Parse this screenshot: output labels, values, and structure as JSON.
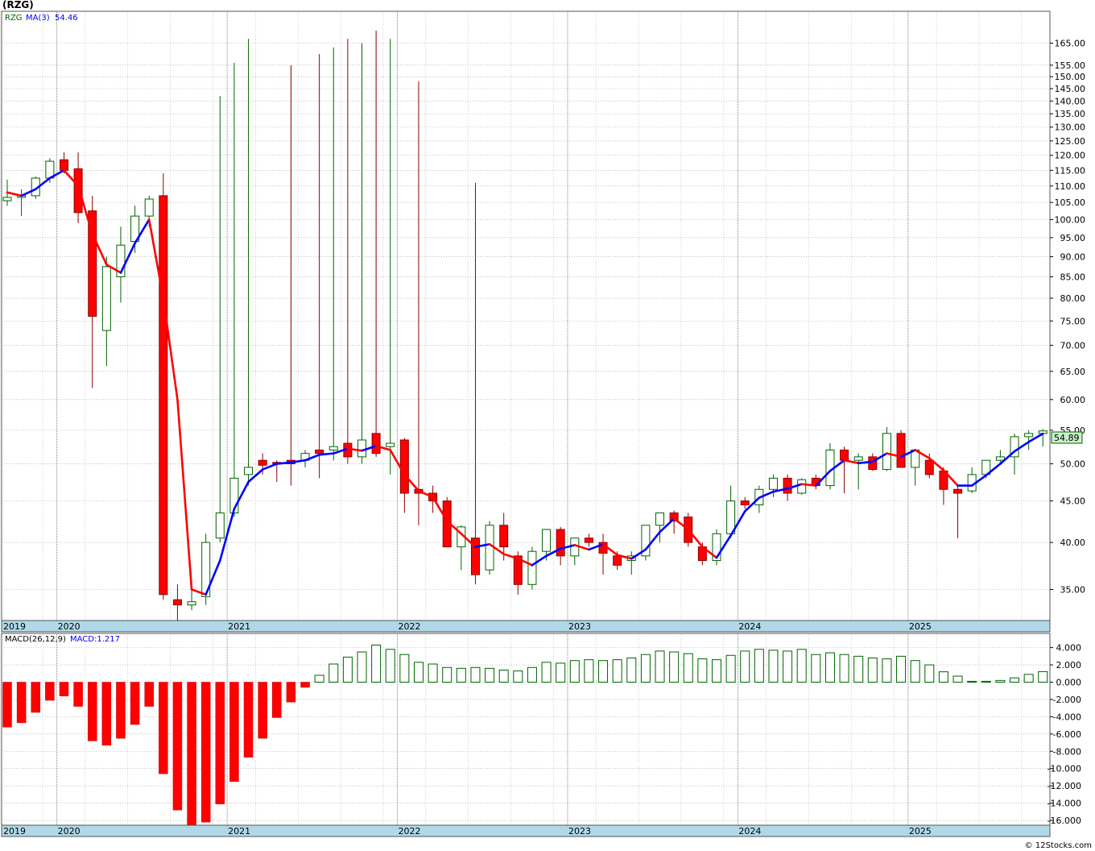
{
  "header": {
    "title": "(RZG)"
  },
  "legend": {
    "ticker": "RZG",
    "ma_label": "MA(3)",
    "ma_value": "54.46",
    "last_price": "54.89",
    "macd_label": "MACD(26,12,9)",
    "macd_value": "MACD:1.217"
  },
  "footer": {
    "copyright": "© 12Stocks.com"
  },
  "colors": {
    "up_candle": "#006400",
    "down_candle": "#8b0000",
    "down_fill": "#ff0000",
    "ma_up": "#0000ff",
    "ma_down": "#ff0000",
    "axis_band": "#b0d8e8",
    "last_price_box": "#c8f0c8",
    "macd_pos": "#006400",
    "macd_neg": "#ff0000"
  },
  "chart_data": {
    "type": "candlestick",
    "frequency": "monthly",
    "price_axis_scale": "log",
    "price_ticks": [
      35,
      40,
      45,
      50,
      55,
      60,
      65,
      70,
      75,
      80,
      85,
      90,
      95,
      100,
      105,
      110,
      115,
      120,
      125,
      130,
      135,
      140,
      145,
      150,
      155,
      165
    ],
    "price_tick_labels": [
      "35.00",
      "40.00",
      "45.00",
      "50.00",
      "55.00",
      "60.00",
      "65.00",
      "70.00",
      "75.00",
      "80.00",
      "85.00",
      "90.00",
      "95.00",
      "100.00",
      "105.00",
      "110.00",
      "115.00",
      "120.00",
      "125.00",
      "130.00",
      "135.00",
      "140.00",
      "145.00",
      "150.00",
      "155.00",
      "165.00"
    ],
    "macd_ticks": [
      4,
      2,
      0,
      -2,
      -4,
      -6,
      -8,
      -10,
      -12,
      -14,
      -16
    ],
    "macd_tick_labels": [
      "4.000",
      "2.000",
      "0.000",
      "-2.000",
      "-4.000",
      "-6.000",
      "-8.000",
      "-10.000",
      "-12.000",
      "-14.000",
      "-16.000"
    ],
    "year_labels": [
      "2019",
      "2020",
      "2021",
      "2022",
      "2023",
      "2024",
      "2025"
    ],
    "year_months": [
      0,
      4,
      16,
      28,
      40,
      52,
      64
    ],
    "candles": [
      {
        "o": 105.5,
        "h": 112,
        "l": 104,
        "c": 106.5
      },
      {
        "o": 106.5,
        "h": 109,
        "l": 101,
        "c": 107
      },
      {
        "o": 107,
        "h": 113,
        "l": 106,
        "c": 112.5
      },
      {
        "o": 112.5,
        "h": 119,
        "l": 111,
        "c": 118
      },
      {
        "o": 118.5,
        "h": 121,
        "l": 114,
        "c": 115
      },
      {
        "o": 115.5,
        "h": 121,
        "l": 99,
        "c": 102
      },
      {
        "o": 102.5,
        "h": 107,
        "l": 62,
        "c": 76
      },
      {
        "o": 73,
        "h": 90,
        "l": 66,
        "c": 87.5
      },
      {
        "o": 85,
        "h": 98,
        "l": 79,
        "c": 93
      },
      {
        "o": 94,
        "h": 104,
        "l": 91,
        "c": 101
      },
      {
        "o": 101,
        "h": 107,
        "l": 98,
        "c": 106
      },
      {
        "o": 107,
        "h": 114,
        "l": 34,
        "c": 34.5
      },
      {
        "o": 34,
        "h": 35.5,
        "l": 32,
        "c": 33.5
      },
      {
        "o": 33.5,
        "h": 35,
        "l": 33,
        "c": 33.8
      },
      {
        "o": 34.3,
        "h": 41,
        "l": 33.5,
        "c": 40
      },
      {
        "o": 40.5,
        "h": 142,
        "l": 40,
        "c": 43.5
      },
      {
        "o": 43.5,
        "h": 156,
        "l": 43,
        "c": 48
      },
      {
        "o": 48.5,
        "h": 167,
        "l": 47,
        "c": 49.5
      },
      {
        "o": 50.5,
        "h": 51.5,
        "l": 48.5,
        "c": 49.8
      },
      {
        "o": 50.2,
        "h": 50.5,
        "l": 47.5,
        "c": 50
      },
      {
        "o": 50.5,
        "h": 155,
        "l": 47,
        "c": 50
      },
      {
        "o": 50.5,
        "h": 52,
        "l": 49.5,
        "c": 51.5
      },
      {
        "o": 52,
        "h": 160,
        "l": 48,
        "c": 51.5
      },
      {
        "o": 52,
        "h": 163,
        "l": 50.5,
        "c": 52.5
      },
      {
        "o": 53,
        "h": 167,
        "l": 50,
        "c": 51
      },
      {
        "o": 51,
        "h": 165,
        "l": 50,
        "c": 53.5
      },
      {
        "o": 54.5,
        "h": 171,
        "l": 51,
        "c": 51.5
      },
      {
        "o": 52.5,
        "h": 167,
        "l": 48.5,
        "c": 53
      },
      {
        "o": 53.5,
        "h": 53.8,
        "l": 43.5,
        "c": 46
      },
      {
        "o": 46.5,
        "h": 148,
        "l": 42,
        "c": 46
      },
      {
        "o": 46,
        "h": 47,
        "l": 43.5,
        "c": 45
      },
      {
        "o": 45,
        "h": 45.5,
        "l": 39.5,
        "c": 39.5
      },
      {
        "o": 39.5,
        "h": 42,
        "l": 37,
        "c": 41.8
      },
      {
        "o": 40.5,
        "h": 111,
        "l": 35.5,
        "c": 36.5
      },
      {
        "o": 37,
        "h": 42.5,
        "l": 36.5,
        "c": 42
      },
      {
        "o": 42,
        "h": 43.5,
        "l": 38,
        "c": 39.5
      },
      {
        "o": 38.5,
        "h": 39,
        "l": 34.5,
        "c": 35.5
      },
      {
        "o": 35.5,
        "h": 39.5,
        "l": 35,
        "c": 39
      },
      {
        "o": 39,
        "h": 41.5,
        "l": 38,
        "c": 41.5
      },
      {
        "o": 41.5,
        "h": 41.8,
        "l": 37.5,
        "c": 38.5
      },
      {
        "o": 38.5,
        "h": 40.5,
        "l": 37.5,
        "c": 40.5
      },
      {
        "o": 40.5,
        "h": 41,
        "l": 39.5,
        "c": 40
      },
      {
        "o": 40,
        "h": 41,
        "l": 36.5,
        "c": 38.8
      },
      {
        "o": 38.5,
        "h": 39,
        "l": 37,
        "c": 37.5
      },
      {
        "o": 38,
        "h": 39,
        "l": 36.5,
        "c": 38.5
      },
      {
        "o": 38.5,
        "h": 42,
        "l": 38,
        "c": 42
      },
      {
        "o": 42,
        "h": 43.5,
        "l": 40,
        "c": 43.5
      },
      {
        "o": 43.5,
        "h": 43.8,
        "l": 41,
        "c": 42.5
      },
      {
        "o": 43,
        "h": 43.5,
        "l": 39.5,
        "c": 40
      },
      {
        "o": 39.5,
        "h": 40,
        "l": 37.5,
        "c": 38
      },
      {
        "o": 38,
        "h": 41.5,
        "l": 37.5,
        "c": 41
      },
      {
        "o": 41,
        "h": 47,
        "l": 40.5,
        "c": 45
      },
      {
        "o": 45,
        "h": 45.5,
        "l": 44,
        "c": 44.5
      },
      {
        "o": 44.5,
        "h": 47,
        "l": 43.5,
        "c": 46.5
      },
      {
        "o": 46.5,
        "h": 48.5,
        "l": 45.5,
        "c": 48
      },
      {
        "o": 48,
        "h": 48.5,
        "l": 45,
        "c": 46
      },
      {
        "o": 46,
        "h": 48,
        "l": 45.8,
        "c": 47.8
      },
      {
        "o": 48,
        "h": 48.5,
        "l": 46.5,
        "c": 47
      },
      {
        "o": 47,
        "h": 53,
        "l": 46.5,
        "c": 52
      },
      {
        "o": 52,
        "h": 52.5,
        "l": 46,
        "c": 50.5
      },
      {
        "o": 50.5,
        "h": 51.5,
        "l": 46.5,
        "c": 51
      },
      {
        "o": 51,
        "h": 51.5,
        "l": 49,
        "c": 49.2
      },
      {
        "o": 49.2,
        "h": 55.5,
        "l": 49,
        "c": 54.5
      },
      {
        "o": 54.5,
        "h": 55,
        "l": 49.5,
        "c": 49.5
      },
      {
        "o": 49.5,
        "h": 52,
        "l": 47,
        "c": 52
      },
      {
        "o": 50.5,
        "h": 51.5,
        "l": 48,
        "c": 48.5
      },
      {
        "o": 49,
        "h": 49.5,
        "l": 44.5,
        "c": 46.5
      },
      {
        "o": 46.5,
        "h": 47,
        "l": 40.5,
        "c": 46
      },
      {
        "o": 46.3,
        "h": 49.5,
        "l": 46,
        "c": 48.5
      },
      {
        "o": 48.5,
        "h": 50.5,
        "l": 48,
        "c": 50.5
      },
      {
        "o": 50.5,
        "h": 52,
        "l": 50,
        "c": 51
      },
      {
        "o": 51,
        "h": 54.5,
        "l": 48.5,
        "c": 54
      },
      {
        "o": 54,
        "h": 55,
        "l": 52,
        "c": 54.5
      },
      {
        "o": 54.5,
        "h": 55.2,
        "l": 52.5,
        "c": 54.89
      }
    ],
    "ma": [
      108,
      107,
      109,
      112.5,
      115,
      110,
      96,
      88,
      86,
      93.5,
      100,
      80,
      60,
      35,
      34.5,
      38,
      44,
      47.5,
      49.2,
      50,
      50.2,
      50.5,
      51.3,
      51.5,
      52.2,
      51.9,
      52.6,
      52,
      48.5,
      46.3,
      45.5,
      42.5,
      41,
      39.5,
      39.8,
      38.7,
      38.2,
      37.5,
      38.5,
      39.3,
      39.7,
      39.2,
      39.8,
      38.6,
      38.2,
      39.2,
      41.2,
      42.8,
      41.5,
      39.5,
      38.3,
      40.8,
      43.7,
      45.4,
      46.2,
      46.6,
      47.2,
      47,
      49,
      50.5,
      50.1,
      50.3,
      51.5,
      51,
      52,
      50.8,
      49.1,
      47,
      47,
      48.4,
      50,
      51.8,
      53.2,
      54.46
    ],
    "macd": [
      -5.2,
      -4.7,
      -3.5,
      -2.1,
      -1.6,
      -2.8,
      -6.8,
      -7.3,
      -6.5,
      -4.9,
      -2.8,
      -10.6,
      -14.8,
      -16.5,
      -16.2,
      -14.1,
      -11.5,
      -8.7,
      -6.5,
      -4.1,
      -2.3,
      -0.6,
      0.8,
      2.1,
      2.9,
      3.5,
      4.3,
      3.8,
      3.2,
      2.3,
      2.1,
      1.7,
      1.6,
      1.7,
      1.6,
      1.4,
      1.3,
      1.7,
      2.3,
      2.2,
      2.5,
      2.6,
      2.5,
      2.6,
      2.8,
      3.2,
      3.6,
      3.5,
      3.3,
      2.7,
      2.6,
      3.1,
      3.6,
      3.8,
      3.7,
      3.6,
      3.8,
      3.2,
      3.4,
      3.2,
      3,
      2.8,
      2.7,
      3,
      2.5,
      2,
      1.2,
      0.7,
      0.1,
      0.1,
      0.2,
      0.5,
      0.9,
      1.217
    ]
  }
}
